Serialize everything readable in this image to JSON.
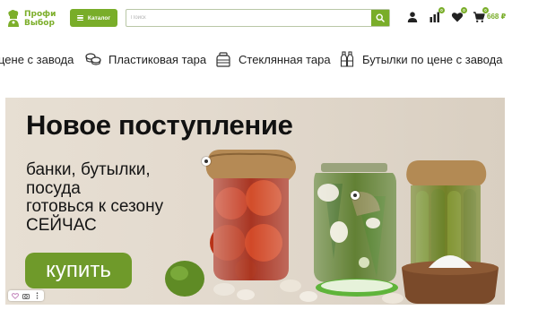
{
  "header": {
    "logo_line1": "Профи",
    "logo_line2": "Выбор",
    "catalog_label": "Каталог",
    "search_placeholder": "Поиск",
    "compare_badge": "0",
    "favorites_badge": "0",
    "cart_badge": "0",
    "cart_price": "668 ₽"
  },
  "categories": [
    {
      "label": "цене с завода",
      "icon": "bottle-icon"
    },
    {
      "label": "Пластиковая тара",
      "icon": "plastic-containers-icon"
    },
    {
      "label": "Стеклянная тара",
      "icon": "glass-jar-icon"
    },
    {
      "label": "Бутылки по цене с завода",
      "icon": "bottles-icon"
    }
  ],
  "banner": {
    "title": "Новое поступление",
    "subtitle_1": "банки, бутылки,",
    "subtitle_2": "посуда",
    "subtitle_3": "готовься к сезону",
    "subtitle_4": "СЕЙЧАС",
    "cta": "купить"
  },
  "colors": {
    "accent": "#79ad29",
    "banner_button": "#6f9a2a"
  }
}
